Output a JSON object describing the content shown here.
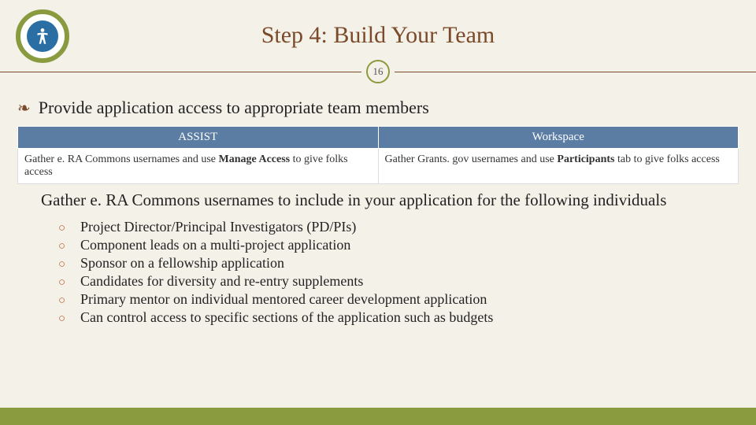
{
  "title": "Step 4: Build Your Team",
  "page_number": "16",
  "main_bullet": "Provide application access to appropriate team members",
  "table": {
    "headers": [
      "ASSIST",
      "Workspace"
    ],
    "row": {
      "assist_prefix": "Gather e. RA Commons usernames and use ",
      "assist_bold": "Manage Access",
      "assist_suffix": " to give folks access",
      "workspace_prefix": "Gather Grants. gov usernames and use ",
      "workspace_bold": "Participants",
      "workspace_suffix": " tab to give folks access"
    }
  },
  "sub_heading": "Gather e. RA Commons usernames to include in your application for the following individuals",
  "roles": [
    "Project Director/Principal Investigators (PD/PIs)",
    "Component leads on a multi-project application",
    "Sponsor on a fellowship application",
    "Candidates for diversity and re-entry supplements",
    "Primary mentor on individual mentored career development application",
    "Can control access to specific sections of the application such as budgets"
  ]
}
